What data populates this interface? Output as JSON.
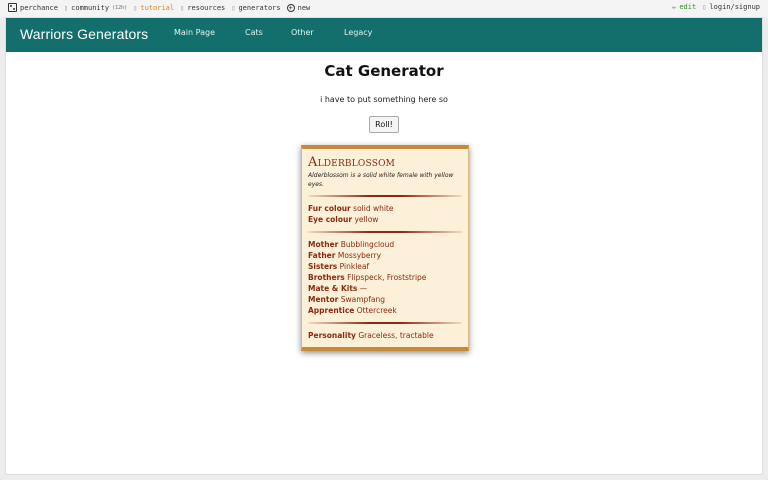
{
  "topbar": {
    "brand": "perchance",
    "community": "community",
    "community_badge": "(12h)",
    "tutorial": "tutorial",
    "resources": "resources",
    "generators": "generators",
    "new": "new",
    "edit": "edit",
    "login": "login/signup"
  },
  "nav": {
    "brand": "Warriors Generators",
    "links": [
      "Main Page",
      "Cats",
      "Other",
      "Legacy"
    ]
  },
  "main": {
    "title": "Cat Generator",
    "subtitle": "i have to put something here so",
    "roll_label": "Roll!"
  },
  "card": {
    "name": "Alderblossom",
    "description": "Alderblossom is a solid white female with yellow eyes.",
    "appearance": [
      {
        "label": "Fur colour",
        "value": "solid white"
      },
      {
        "label": "Eye colour",
        "value": "yellow"
      }
    ],
    "relations": [
      {
        "label": "Mother",
        "value": "Bubblingcloud"
      },
      {
        "label": "Father",
        "value": "Mossyberry"
      },
      {
        "label": "Sisters",
        "value": "Pinkleaf"
      },
      {
        "label": "Brothers",
        "value": "Flipspeck, Froststripe"
      },
      {
        "label": "Mate & Kits",
        "value": "—"
      },
      {
        "label": "Mentor",
        "value": "Swampfang"
      },
      {
        "label": "Apprentice",
        "value": "Ottercreek"
      }
    ],
    "personality": {
      "label": "Personality",
      "value": "Graceless, tractable"
    }
  },
  "colors": {
    "nav_bg": "#136f6b",
    "card_bg": "#fdf0d8",
    "card_text": "#8a2a12",
    "card_border": "#c78a3d"
  }
}
